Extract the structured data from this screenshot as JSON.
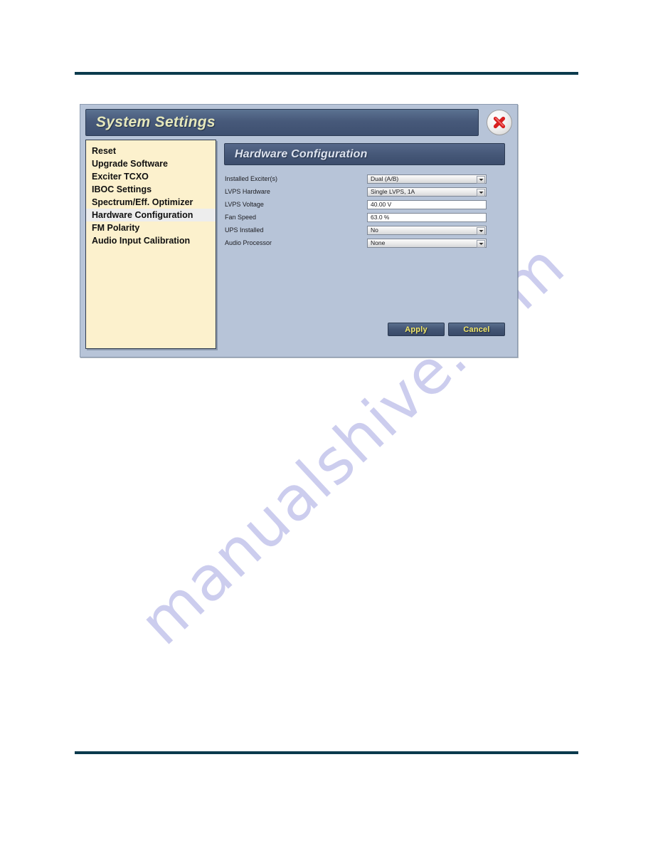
{
  "page": {
    "rule_color": "#0b3a4d",
    "watermark": "manualshive.com",
    "watermark_color": "#b9bbe8"
  },
  "dialog": {
    "title": "System Settings",
    "title_color": "#e6e8bc",
    "close_icon": "close-x-icon"
  },
  "sidebar": {
    "items": [
      {
        "label": "Reset",
        "selected": false
      },
      {
        "label": "Upgrade Software",
        "selected": false
      },
      {
        "label": "Exciter TCXO",
        "selected": false
      },
      {
        "label": "IBOC Settings",
        "selected": false
      },
      {
        "label": "Spectrum/Eff. Optimizer",
        "selected": false
      },
      {
        "label": "Hardware Configuration",
        "selected": true
      },
      {
        "label": "FM Polarity",
        "selected": false
      },
      {
        "label": "Audio Input Calibration",
        "selected": false
      }
    ]
  },
  "panel": {
    "header": "Hardware Configuration",
    "fields": [
      {
        "label": "Installed Exciter(s)",
        "value": "Dual (A/B)",
        "type": "select"
      },
      {
        "label": "LVPS Hardware",
        "value": "Single LVPS, 1A",
        "type": "select"
      },
      {
        "label": "LVPS Voltage",
        "value": "40.00 V",
        "type": "text"
      },
      {
        "label": "Fan Speed",
        "value": "63.0 %",
        "type": "text"
      },
      {
        "label": "UPS Installed",
        "value": "No",
        "type": "select"
      },
      {
        "label": "Audio Processor",
        "value": "None",
        "type": "select"
      }
    ],
    "buttons": {
      "apply": "Apply",
      "cancel": "Cancel",
      "text_color": "#f4e96a"
    }
  }
}
